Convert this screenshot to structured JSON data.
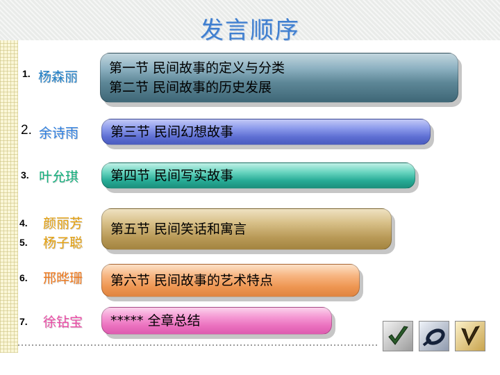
{
  "slide": {
    "title": "发言顺序",
    "rows": [
      {
        "num": "1.",
        "name": "杨森丽",
        "name_color": "#1e7fc8",
        "lines": [
          "第一节  民间故事的定义与分类",
          "第二节  民间故事的历史发展"
        ]
      },
      {
        "num": "2.",
        "name": "余诗雨",
        "name_color": "#2e7fe0",
        "lines": [
          "第三节  民间幻想故事"
        ]
      },
      {
        "num": "3.",
        "name": "叶允琪",
        "name_color": "#14b07d",
        "lines": [
          "第四节  民间写实故事"
        ]
      },
      {
        "num": "4.",
        "name": "颜丽芳",
        "name_color": "#e6a10e",
        "lines": [
          "第五节  民间笑话和寓言"
        ]
      },
      {
        "num": "5.",
        "name": "杨子聪",
        "name_color": "#e6a10e"
      },
      {
        "num": "6.",
        "name": "邢晔珊",
        "name_color": "#f07a1e",
        "lines": [
          "第六节  民间故事的艺术特点"
        ]
      },
      {
        "num": "7.",
        "name": "徐钻宝",
        "name_color": "#ec4aa6",
        "lines": [
          "*****      全章总结"
        ]
      }
    ],
    "decor_icons": [
      "check-mark-icon",
      "loop-mark-icon",
      "v-mark-icon"
    ]
  }
}
